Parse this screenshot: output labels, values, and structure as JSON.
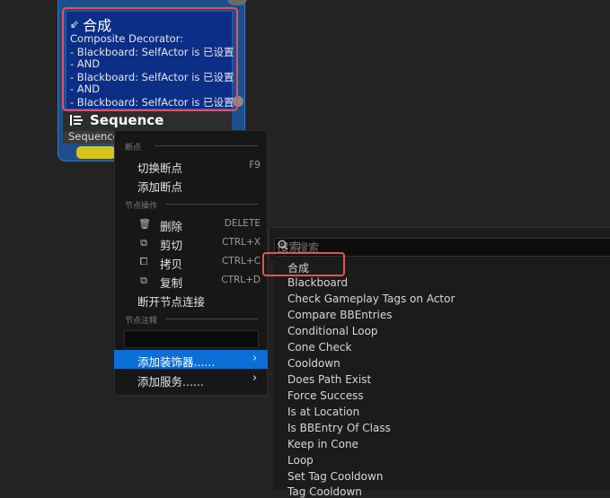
{
  "composite_node": {
    "title": "合成",
    "icon": "composite-arrow-icon",
    "lines": [
      "Composite Decorator:",
      "- Blackboard: SelfActor is 已设置",
      "- AND",
      "- Blackboard: SelfActor is 已设置",
      "- AND",
      "- Blackboard: SelfActor is 已设置"
    ]
  },
  "sequence_node": {
    "title": "Sequence",
    "icon": "sequence-icon",
    "subtitle": "Sequence"
  },
  "context_menu": {
    "sections": {
      "breakpoints": "断点",
      "node_actions": "节点操作",
      "node_comment": "节点注释"
    },
    "items": {
      "toggle_breakpoint": {
        "label": "切换断点",
        "shortcut": "F9"
      },
      "add_breakpoint": {
        "label": "添加断点"
      },
      "delete": {
        "label": "删除",
        "shortcut": "DELETE",
        "icon": "trash-icon"
      },
      "cut": {
        "label": "剪切",
        "shortcut": "CTRL+X",
        "icon": "cut-icon"
      },
      "copy": {
        "label": "拷贝",
        "shortcut": "CTRL+C",
        "icon": "copy-icon"
      },
      "duplicate": {
        "label": "复制",
        "shortcut": "CTRL+D",
        "icon": "duplicate-icon"
      },
      "break_links": {
        "label": "断开节点连接"
      },
      "add_decorator": {
        "label": "添加装饰器......"
      },
      "add_service": {
        "label": "添加服务......"
      }
    },
    "comment_value": "",
    "highlight_color": "#0a6fd6"
  },
  "submenu": {
    "search_placeholder": "搜索",
    "items": [
      "合成",
      "Blackboard",
      "Check Gameplay Tags on Actor",
      "Compare BBEntries",
      "Conditional Loop",
      "Cone Check",
      "Cooldown",
      "Does Path Exist",
      "Force Success",
      "Is at Location",
      "Is BBEntry Of Class",
      "Keep in Cone",
      "Loop",
      "Set Tag Cooldown",
      "Tag Cooldown"
    ]
  },
  "annotation_color": "#e0545a"
}
